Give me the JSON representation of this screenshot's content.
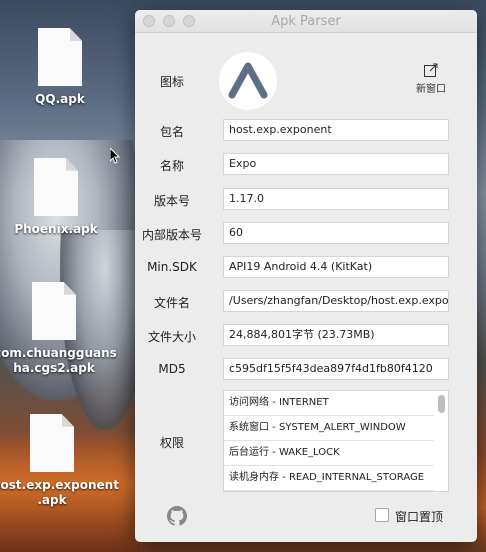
{
  "desktop": {
    "icons": [
      {
        "label": "QQ.apk"
      },
      {
        "label": "Phoenix.apk"
      },
      {
        "label_line1": "com.chuangguans",
        "label_line2": "ha.cgs2.apk"
      },
      {
        "label_line1": "host.exp.exponent",
        "label_line2": ".apk"
      }
    ]
  },
  "window": {
    "title": "Apk Parser",
    "icon_label": "图标",
    "new_window_label": "新窗口",
    "fields": {
      "package": {
        "label": "包名",
        "value": "host.exp.exponent"
      },
      "name": {
        "label": "名称",
        "value": "Expo"
      },
      "version": {
        "label": "版本号",
        "value": "1.17.0"
      },
      "version_code": {
        "label": "内部版本号",
        "value": "60"
      },
      "min_sdk": {
        "label": "Min.SDK",
        "value": "API19 Android 4.4 (KitKat)"
      },
      "file_name": {
        "label": "文件名",
        "value": "/Users/zhangfan/Desktop/host.exp.exponent.apk"
      },
      "file_size": {
        "label": "文件大小",
        "value": "24,884,801字节 (23.73MB)"
      },
      "md5": {
        "label": "MD5",
        "value": "c595df15f5f43dea897f4d1fb80f4120"
      }
    },
    "permissions_label": "权限",
    "permissions": [
      "访问网络 - INTERNET",
      "系统窗口 - SYSTEM_ALERT_WINDOW",
      "后台运行 - WAKE_LOCK",
      "读机身内存 - READ_INTERNAL_STORAGE"
    ],
    "pin_window_label": "窗口置顶",
    "pin_window_checked": false
  }
}
